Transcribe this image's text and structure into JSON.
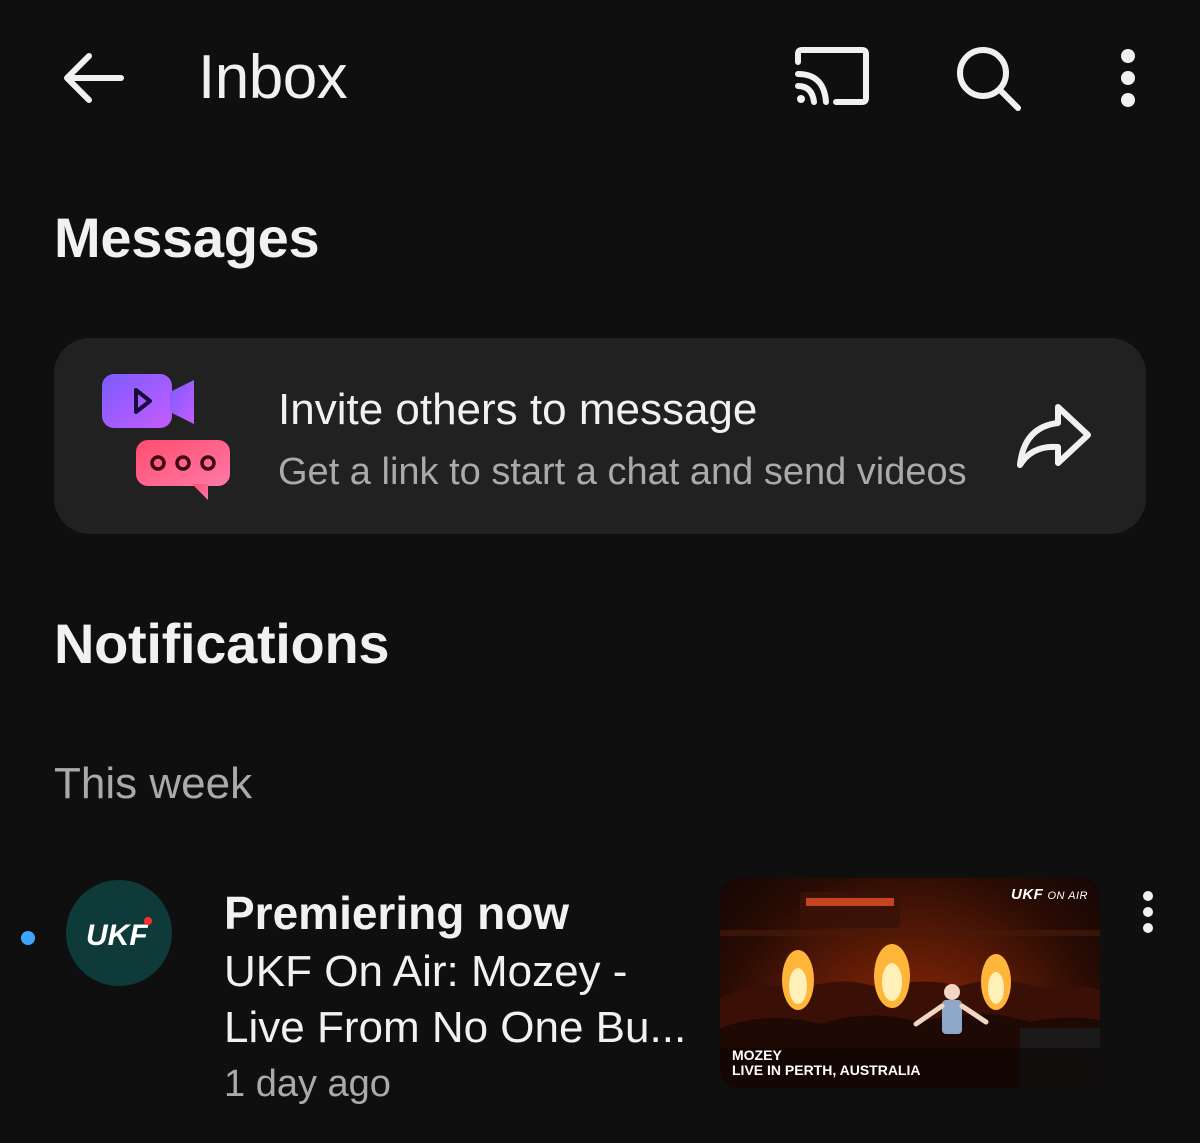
{
  "header": {
    "title": "Inbox",
    "icons": {
      "back": "arrow-left-icon",
      "cast": "cast-icon",
      "search": "search-icon",
      "more": "more-vert-icon"
    }
  },
  "messages": {
    "heading": "Messages",
    "invite_card": {
      "title": "Invite others to message",
      "subtitle": "Get a link to start a chat and send videos",
      "icon": "video-chat-icon",
      "action_icon": "share-arrow-icon"
    }
  },
  "notifications": {
    "heading": "Notifications",
    "group_label": "This week",
    "items": [
      {
        "unread": true,
        "channel_avatar_text": "UKF",
        "headline": "Premiering now",
        "body_line1": "UKF On Air: Mozey -",
        "body_line2": "Live From No One Bu...",
        "time": "1 day ago",
        "thumbnail": {
          "brand": "UKF",
          "brand_suffix": "ON AIR",
          "caption_line1": "MOZEY",
          "caption_line2": "LIVE IN PERTH, AUSTRALIA"
        }
      }
    ]
  },
  "colors": {
    "background": "#0f0f0f",
    "card": "#212121",
    "secondary_text": "#aaaaaa",
    "unread_dot": "#3ea6ff"
  }
}
